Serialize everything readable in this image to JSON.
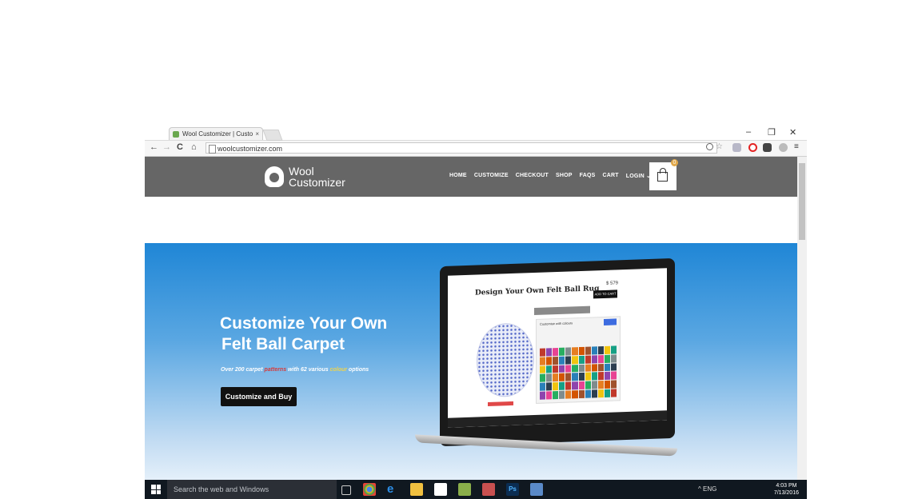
{
  "browser": {
    "tab_title": "Wool Customizer | Custo",
    "tab_close": "×",
    "window_controls": [
      "–",
      "❐",
      "✕"
    ],
    "nav_icons": [
      "←",
      "→",
      "C",
      "⌂"
    ],
    "url": "woolcustomizer.com",
    "extension_icon_names": [
      "zoom-icon",
      "star-icon",
      "shield-icon",
      "opera-icon",
      "pocket-icon",
      "extension-icon",
      "menu-icon"
    ]
  },
  "site": {
    "logo_line1": "Wool",
    "logo_line2": "Customizer",
    "nav": [
      "HOME",
      "CUSTOMIZE",
      "CHECKOUT",
      "SHOP",
      "FAQS",
      "CART",
      "LOGIN ⌄"
    ],
    "cart_badge": "0"
  },
  "hero": {
    "headline_line1": "Customize Your Own",
    "headline_line2": "Felt Ball Carpet",
    "sub_prefix": "Over 200 carpet ",
    "sub_patterns": "patterns",
    "sub_mid": " with 62 various ",
    "sub_colour": "colour",
    "sub_suffix": " options",
    "cta": "Customize and Buy",
    "colors": {
      "gradient_top": "#1f86d6",
      "cta_bg": "#111111",
      "patterns_accent": "#d63b3b",
      "colour_accent": "#f1d44a"
    }
  },
  "mockup": {
    "title": "Design Your Own Felt Ball Rug",
    "price": "$ 579",
    "button": "ADD TO CART",
    "panel_heading": "Customise with colours"
  },
  "taskbar": {
    "search_placeholder": "Search the web and Windows",
    "tray_text": "^ ENG",
    "time": "4:03 PM",
    "date": "7/13/2016"
  }
}
